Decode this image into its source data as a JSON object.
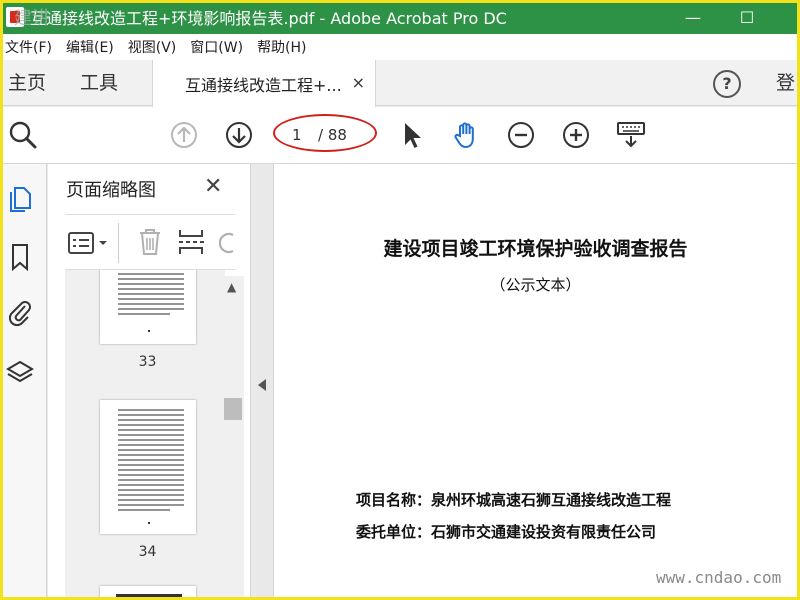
{
  "window": {
    "title": "互通接线改造工程+环境影响报告表.pdf - Adobe Acrobat Pro DC",
    "minimize": "—",
    "maximize": "☐"
  },
  "menu": [
    "文件(F)",
    "编辑(E)",
    "视图(V)",
    "窗口(W)",
    "帮助(H)"
  ],
  "tabs": {
    "home": "主页",
    "tools": "工具",
    "doc": "互通接线改造工程+...",
    "close": "×",
    "help": "?",
    "login": "登"
  },
  "toolbar": {
    "page_current": "1",
    "page_total": "/ 88"
  },
  "thumbnails": {
    "title": "页面缩略图",
    "close": "✕",
    "pages": [
      {
        "label": "33"
      },
      {
        "label": "34"
      }
    ]
  },
  "document": {
    "title": "建设项目竣工环境保护验收调查报告",
    "subtitle": "（公示文本）",
    "project_label": "项目名称：",
    "project_value": "泉州环城高速石狮互通接线改造工程",
    "client_label": "委托单位：",
    "client_value": "石狮市交通建设投资有限责任公司"
  },
  "watermark": {
    "site": "www.cndao.com",
    "logo": "建讲"
  },
  "colors": {
    "titlebar": "#2d9146",
    "annotation": "#d0201a",
    "hand_tool": "#1d6fd1",
    "frame": "#f3e21a"
  }
}
